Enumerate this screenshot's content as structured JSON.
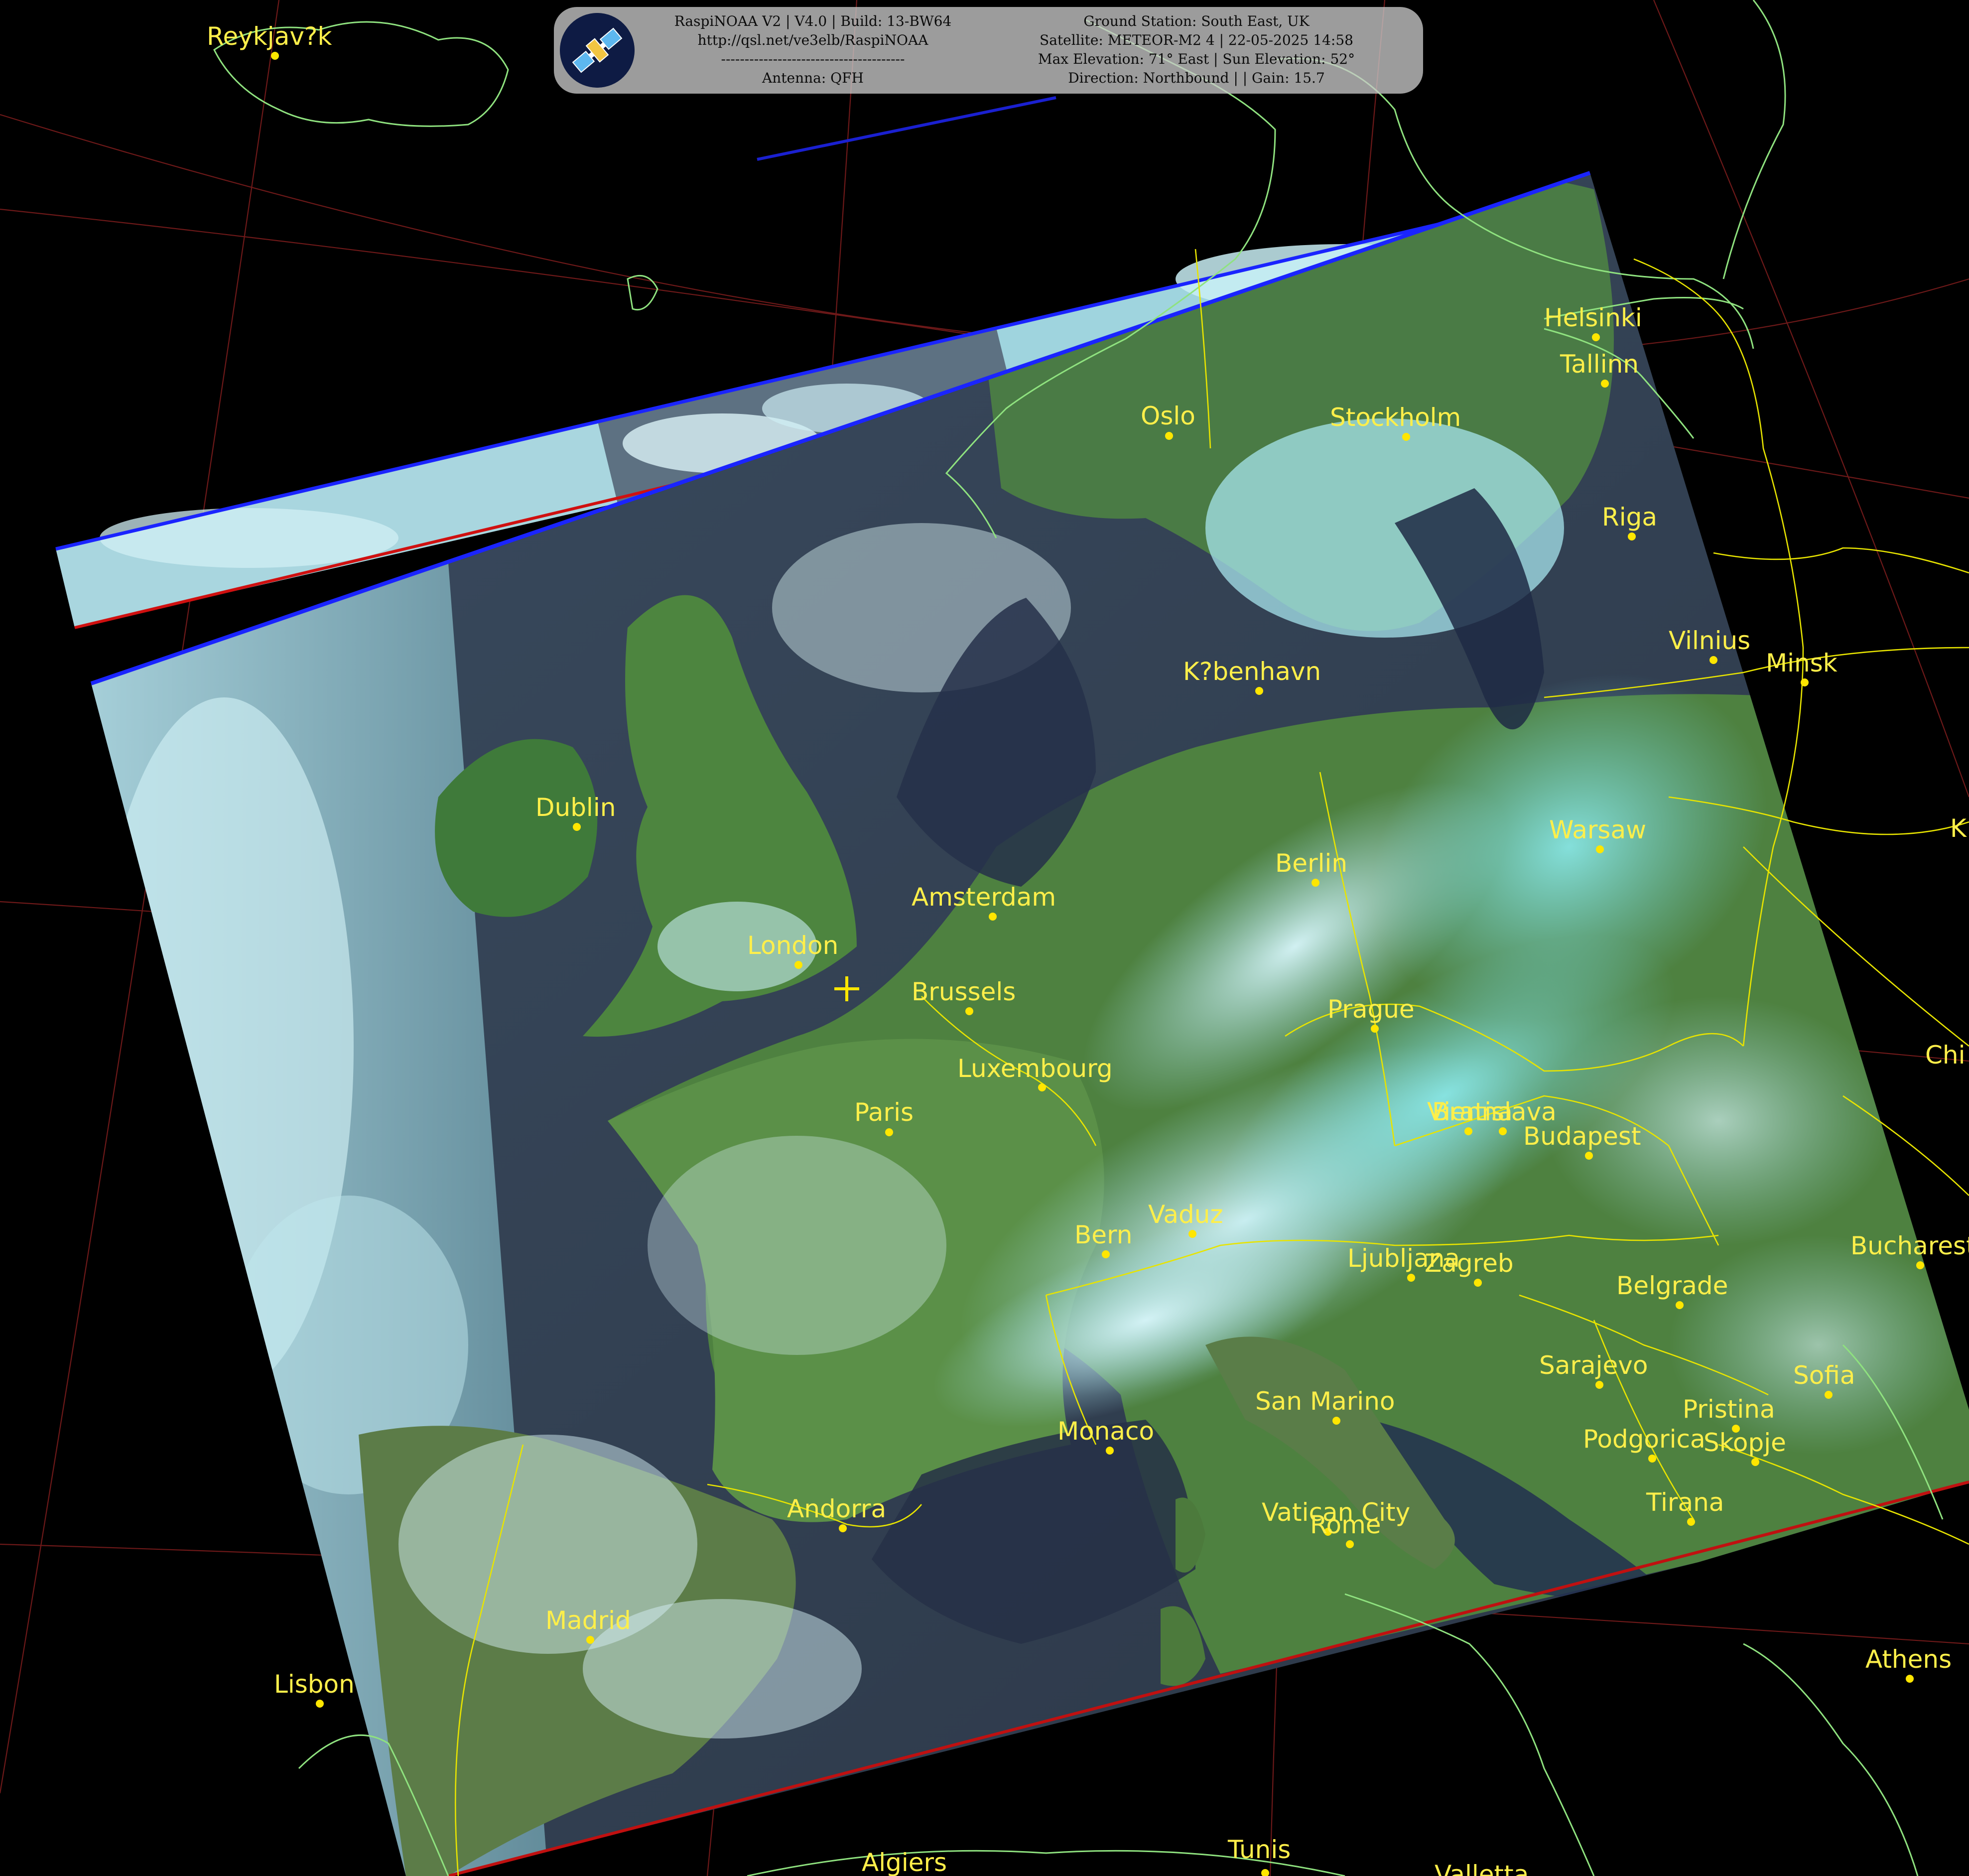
{
  "header": {
    "left_lines": [
      "RaspiNOAA V2 | V4.0 | Build: 13-BW64",
      "http://qsl.net/ve3elb/RaspiNOAA",
      "---------------------------------------",
      "Antenna: QFH"
    ],
    "right_lines": [
      "Ground Station: South East, UK",
      "Satellite: METEOR-M2 4 | 22-05-2025 14:58",
      "Max Elevation: 71° East | Sun Elevation: 52°",
      "Direction: Northbound | | Gain: 15.7"
    ],
    "logo_icon": "satellite-icon"
  },
  "cities": [
    {
      "name": "Reykjav?k"
    },
    {
      "name": "Helsinki"
    },
    {
      "name": "Tallinn"
    },
    {
      "name": "Oslo"
    },
    {
      "name": "Stockholm"
    },
    {
      "name": "Riga"
    },
    {
      "name": "Vilnius"
    },
    {
      "name": "Minsk"
    },
    {
      "name": "K?benhavn"
    },
    {
      "name": "Dublin"
    },
    {
      "name": "Warsaw"
    },
    {
      "name": "Berlin"
    },
    {
      "name": "Amsterdam"
    },
    {
      "name": "London"
    },
    {
      "name": "Brussels"
    },
    {
      "name": "Prague"
    },
    {
      "name": "Luxembourg"
    },
    {
      "name": "Paris"
    },
    {
      "name": "Vienna"
    },
    {
      "name": "Bratislava"
    },
    {
      "name": "Budapest"
    },
    {
      "name": "Vaduz"
    },
    {
      "name": "Bern"
    },
    {
      "name": "Ljubljana"
    },
    {
      "name": "Zagreb"
    },
    {
      "name": "Bucharest"
    },
    {
      "name": "Belgrade"
    },
    {
      "name": "Sarajevo"
    },
    {
      "name": "Sofia"
    },
    {
      "name": "San Marino"
    },
    {
      "name": "Pristina"
    },
    {
      "name": "Monaco"
    },
    {
      "name": "Podgorica"
    },
    {
      "name": "Skopje"
    },
    {
      "name": "Tirana"
    },
    {
      "name": "Andorra"
    },
    {
      "name": "Vatican City"
    },
    {
      "name": "Rome"
    },
    {
      "name": "Madrid"
    },
    {
      "name": "Lisbon"
    },
    {
      "name": "Athens"
    },
    {
      "name": "Algiers"
    },
    {
      "name": "Tunis"
    },
    {
      "name": "Valletta"
    },
    {
      "name": "Chi"
    },
    {
      "name": "K"
    }
  ],
  "colors": {
    "label": "#ffef4a",
    "coastline": "#9ef08a",
    "border": "#e6e600",
    "graticule": "#8a2020"
  }
}
